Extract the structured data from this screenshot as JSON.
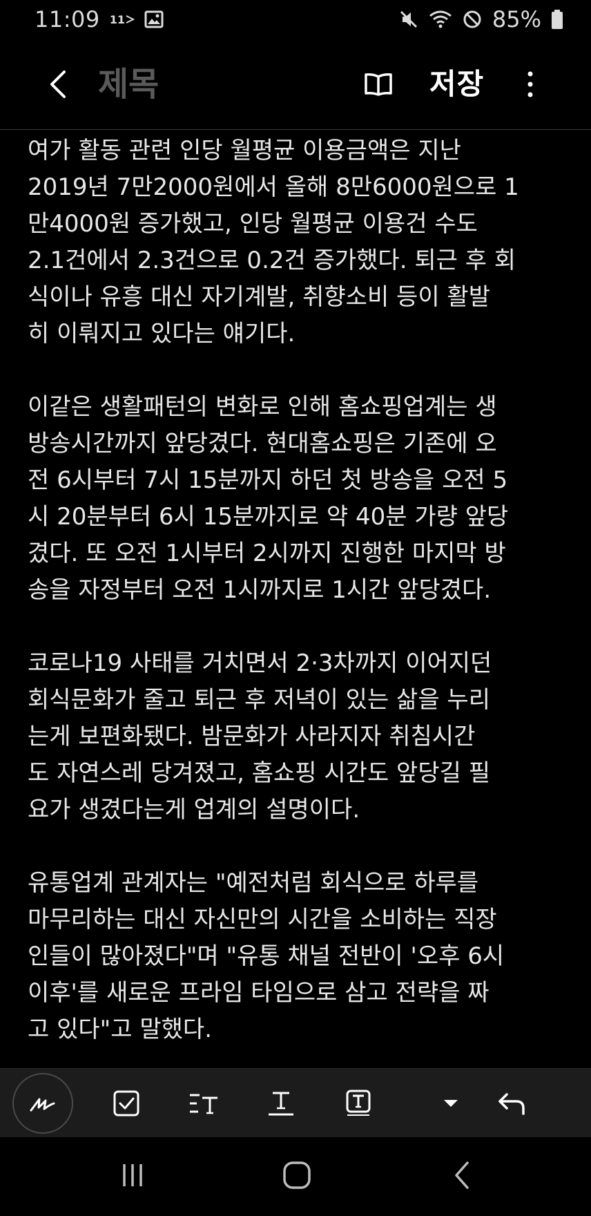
{
  "status_bar": {
    "time": "11:09",
    "network_label": "11",
    "battery": "85%",
    "icons": [
      "cast-icon",
      "gallery-icon",
      "mute-icon",
      "wifi-icon",
      "do-not-disturb-icon",
      "battery-icon"
    ]
  },
  "header": {
    "title": "제목",
    "save_label": "저장",
    "icons": [
      "back-arrow-icon",
      "reader-mode-icon",
      "more-vertical-icon"
    ]
  },
  "content": {
    "paragraphs": [
      "여가 활동 관련 인당 월평균 이용금액은 지난\n2019년 7만2000원에서 올해 8만6000원으로 1\n만4000원 증가했고, 인당 월평균 이용건 수도\n2.1건에서 2.3건으로 0.2건 증가했다. 퇴근 후 회\n식이나 유흥 대신 자기계발, 취향소비 등이 활발\n히 이뤄지고 있다는 얘기다.",
      "이같은 생활패턴의 변화로 인해 홈쇼핑업계는 생\n방송시간까지 앞당겼다. 현대홈쇼핑은 기존에 오\n전 6시부터 7시 15분까지 하던 첫 방송을 오전 5\n시 20분부터 6시 15분까지로 약 40분 가량 앞당\n겼다. 또 오전 1시부터 2시까지 진행한 마지막 방\n송을 자정부터 오전 1시까지로 1시간 앞당겼다.",
      "코로나19 사태를 거치면서 2·3차까지 이어지던\n회식문화가 줄고 퇴근 후 저녁이 있는 삶을 누리\n는게 보편화됐다. 밤문화가 사라지자 취침시간\n도 자연스레 당겨졌고, 홈쇼핑 시간도 앞당길 필\n요가 생겼다는게 업계의 설명이다.",
      "유통업계 관계자는 \"예전처럼 회식으로 하루를\n마무리하는 대신 자신만의 시간을 소비하는 직장\n인들이 많아졌다\"며 \"유통 채널 전반이 '오후 6시\n이후'를 새로운 프라임 타임으로 삼고 전략을 짜\n고 있다\"고 말했다."
    ]
  },
  "toolbar": {
    "icons": [
      "handwriting-pen-icon",
      "checkbox-icon",
      "text-style-icon",
      "text-underline-icon",
      "text-box-icon",
      "dropdown-arrow-icon",
      "undo-icon"
    ]
  },
  "nav_bar": {
    "icons": [
      "recent-apps-icon",
      "home-icon",
      "back-icon"
    ]
  },
  "colors": {
    "background": "#000000",
    "text": "#e8e8e8",
    "title_placeholder": "#5a5a5a",
    "toolbar_bg": "#1c1c1c"
  }
}
